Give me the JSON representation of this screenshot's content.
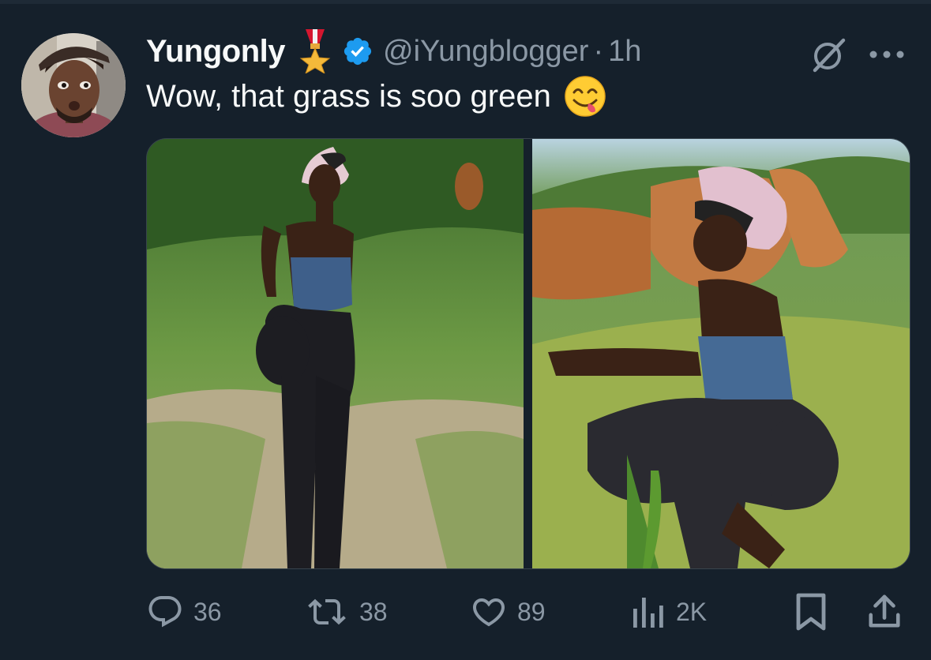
{
  "tweet": {
    "author": {
      "display_name": "Yungonly",
      "handle": "@iYungblogger",
      "time": "1h",
      "separator": "·",
      "badges": [
        "military-medal-icon",
        "verified-badge-icon"
      ]
    },
    "text": "Wow, that grass is soo green",
    "emoji": "face-savoring-food-icon",
    "media": [
      {
        "kind": "photo"
      },
      {
        "kind": "photo"
      }
    ],
    "actions": {
      "replies": "36",
      "reposts": "38",
      "likes": "89",
      "views": "2K"
    }
  },
  "colors": {
    "background": "#15202b",
    "text": "#f7f9f9",
    "muted": "#8b98a5",
    "verified": "#1d9bf0",
    "border": "#38444d"
  }
}
